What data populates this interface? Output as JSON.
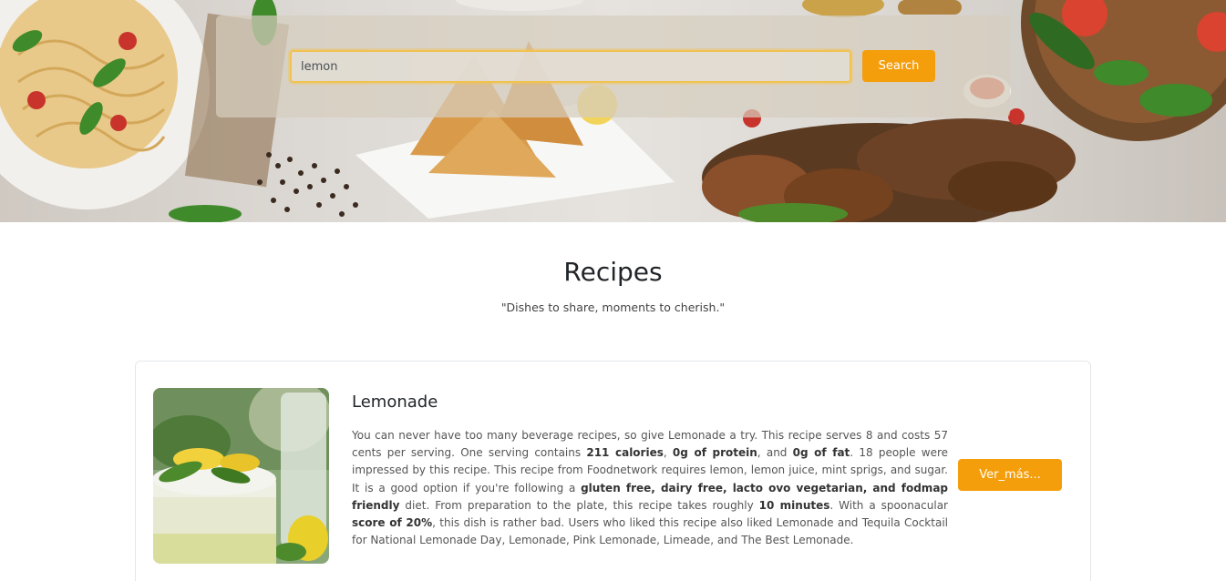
{
  "search": {
    "value": "lemon",
    "button_label": "Search"
  },
  "section": {
    "title": "Recipes",
    "subtitle": "\"Dishes to share, moments to cherish.\""
  },
  "recipes": [
    {
      "title": "Lemonade",
      "summary": [
        {
          "text": "You can never have too many beverage recipes, so give Lemonade a try. This recipe serves 8 and costs 57 cents per serving. One serving contains ",
          "bold": false
        },
        {
          "text": "211 calories",
          "bold": true
        },
        {
          "text": ", ",
          "bold": false
        },
        {
          "text": "0g of protein",
          "bold": true
        },
        {
          "text": ", and ",
          "bold": false
        },
        {
          "text": "0g of fat",
          "bold": true
        },
        {
          "text": ". 18 people were impressed by this recipe. This recipe from Foodnetwork requires lemon, lemon juice, mint sprigs, and sugar. It is a good option if you're following a ",
          "bold": false
        },
        {
          "text": "gluten free, dairy free, lacto ovo vegetarian, and fodmap friendly",
          "bold": true
        },
        {
          "text": " diet. From preparation to the plate, this recipe takes roughly ",
          "bold": false
        },
        {
          "text": "10 minutes",
          "bold": true
        },
        {
          "text": ". With a spoonacular ",
          "bold": false
        },
        {
          "text": "score of 20%",
          "bold": true
        },
        {
          "text": ", this dish is rather bad. Users who liked this recipe also liked Lemonade and Tequila Cocktail for National Lemonade Day, Lemonade, Pink Lemonade, Limeade, and The Best Lemonade.",
          "bold": false
        }
      ],
      "button_label": "Ver_más..."
    }
  ],
  "colors": {
    "accent": "#f59e0b",
    "input_focus": "#f2c24f"
  }
}
